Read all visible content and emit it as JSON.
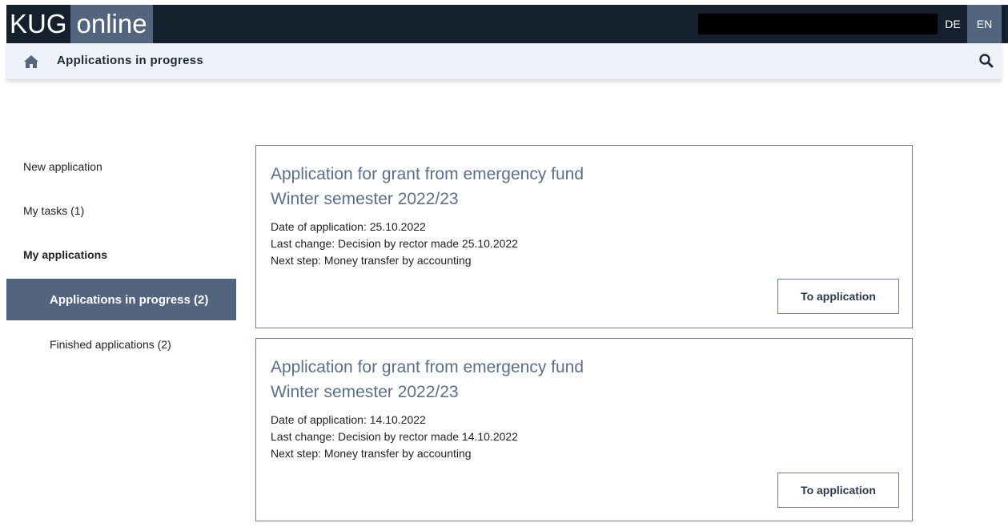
{
  "header": {
    "logo_part1": "KUG",
    "logo_part2": "online",
    "lang_de": "DE",
    "lang_en": "EN"
  },
  "breadcrumb": {
    "icon": "home-icon",
    "title": "Applications in progress",
    "search_icon": "search-icon"
  },
  "sidebar": {
    "items": [
      {
        "label": "New application"
      },
      {
        "label": "My tasks (1)"
      },
      {
        "label": "My applications"
      },
      {
        "label": "Applications in progress (2)"
      },
      {
        "label": "Finished applications (2)"
      }
    ]
  },
  "applications": [
    {
      "title_line1": "Application for grant from emergency fund",
      "title_line2": "Winter semester 2022/23",
      "date": "Date of application: 25.10.2022",
      "last_change": "Last change: Decision by rector made 25.10.2022",
      "next_step": "Next step: Money transfer by accounting",
      "button": "To application"
    },
    {
      "title_line1": "Application for grant from emergency fund",
      "title_line2": "Winter semester 2022/23",
      "date": "Date of application: 14.10.2022",
      "last_change": "Last change: Decision by rector made 14.10.2022",
      "next_step": "Next step: Money transfer by accounting",
      "button": "To application"
    }
  ],
  "colors": {
    "header_bg": "#14202e",
    "accent": "#53657e",
    "breadcrumb_bg": "#eef2f8",
    "title_text": "#5a6f8a"
  }
}
